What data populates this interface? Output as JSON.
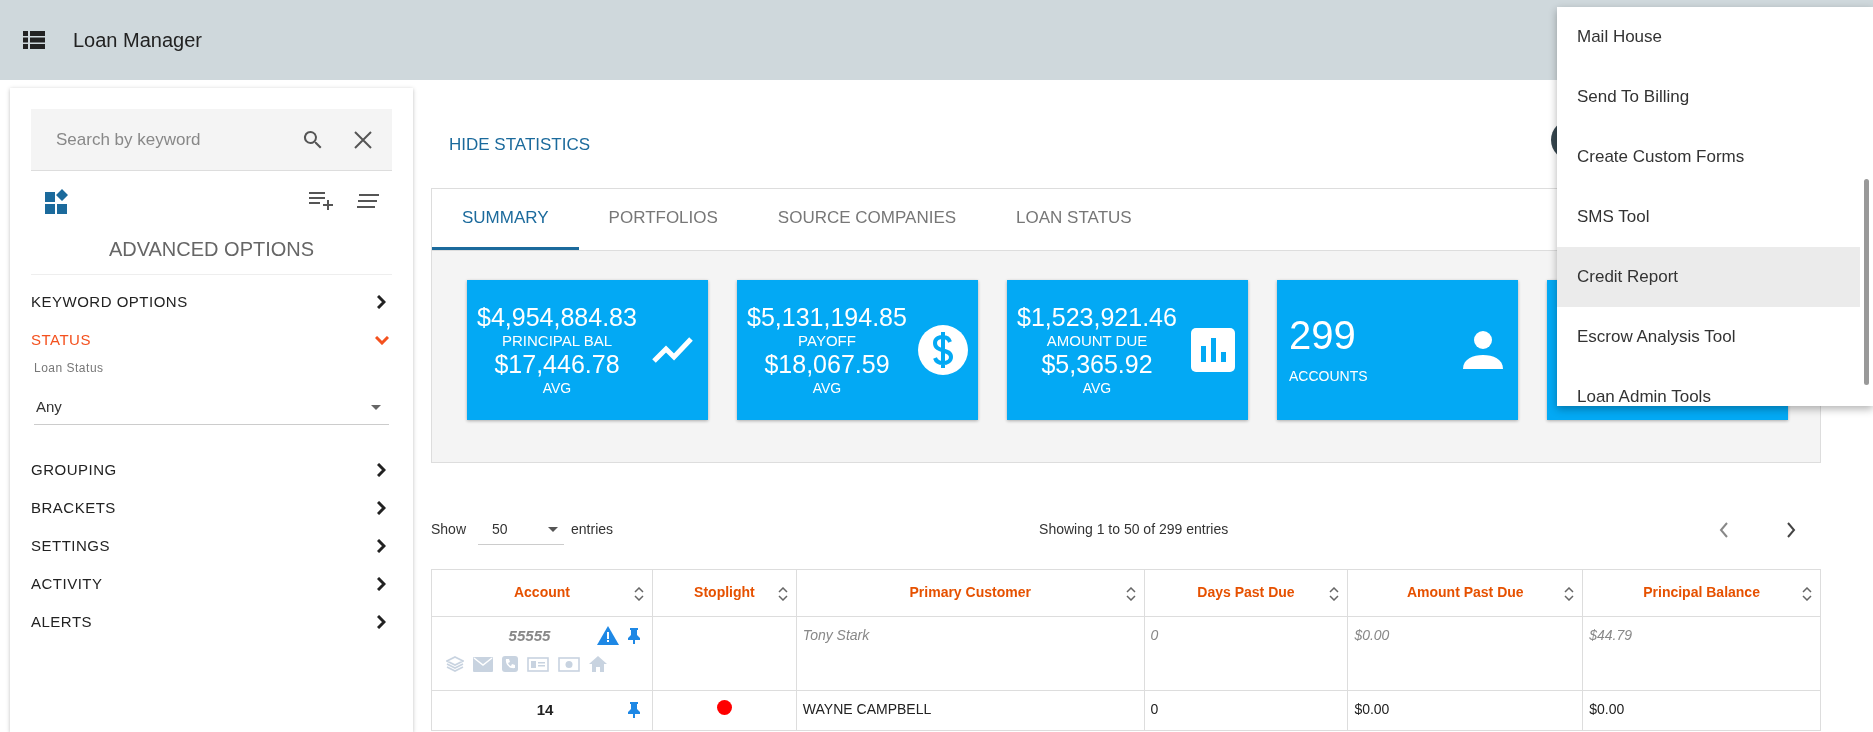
{
  "app_bar": {
    "title": "Loan Manager"
  },
  "sidebar": {
    "search": {
      "placeholder": "Search by keyword"
    },
    "heading": "ADVANCED OPTIONS",
    "sections": [
      {
        "label": "KEYWORD OPTIONS",
        "expanded": false
      },
      {
        "label": "STATUS",
        "expanded": true,
        "field": {
          "label": "Loan Status",
          "value": "Any"
        }
      },
      {
        "label": "GROUPING",
        "expanded": false
      },
      {
        "label": "BRACKETS",
        "expanded": false
      },
      {
        "label": "SETTINGS",
        "expanded": false
      },
      {
        "label": "ACTIVITY",
        "expanded": false
      },
      {
        "label": "ALERTS",
        "expanded": false
      }
    ]
  },
  "statistics": {
    "toggle": "HIDE STATISTICS",
    "tabs": [
      {
        "label": "SUMMARY",
        "selected": true
      },
      {
        "label": "PORTFOLIOS",
        "selected": false
      },
      {
        "label": "SOURCE COMPANIES",
        "selected": false
      },
      {
        "label": "LOAN STATUS",
        "selected": false
      }
    ],
    "cards": [
      {
        "kind": "stat",
        "value": "$4,954,884.83",
        "label": "PRINCIPAL BAL",
        "avg": "$17,446.78",
        "avg_label": "AVG"
      },
      {
        "kind": "stat",
        "value": "$5,131,194.85",
        "label": "PAYOFF",
        "avg": "$18,067.59",
        "avg_label": "AVG"
      },
      {
        "kind": "stat",
        "value": "$1,523,921.46",
        "label": "AMOUNT DUE",
        "avg": "$5,365.92",
        "avg_label": "AVG"
      },
      {
        "kind": "count",
        "value": "299",
        "label": "ACCOUNTS"
      },
      {
        "kind": "blank"
      }
    ]
  },
  "table": {
    "length": {
      "show": "Show",
      "value": "50",
      "entries": "entries"
    },
    "info": "Showing 1 to 50 of 299 entries",
    "columns": [
      "Account",
      "Stoplight",
      "Primary Customer",
      "Days Past Due",
      "Amount Past Due",
      "Principal Balance"
    ],
    "rows": [
      {
        "inactive": true,
        "alert": true,
        "contact_icons": true,
        "account": "55555",
        "customer": "Tony Stark",
        "days": "0",
        "amount": "$0.00",
        "principal": "$44.79"
      },
      {
        "inactive": false,
        "alert": false,
        "contact_icons": false,
        "color": "#ff0000",
        "account": "14",
        "customer": "WAYNE CAMPBELL",
        "days": "0",
        "amount": "$0.00",
        "principal": "$0.00"
      }
    ]
  },
  "menu": {
    "items": [
      {
        "label": "Mail House",
        "selected": false
      },
      {
        "label": "Send To Billing",
        "selected": false
      },
      {
        "label": "Create Custom Forms",
        "selected": false
      },
      {
        "label": "SMS Tool",
        "selected": false
      },
      {
        "label": "Credit Report",
        "selected": true
      },
      {
        "label": "Escrow Analysis Tool",
        "selected": false
      },
      {
        "label": "Loan Admin Tools",
        "selected": false
      }
    ]
  }
}
